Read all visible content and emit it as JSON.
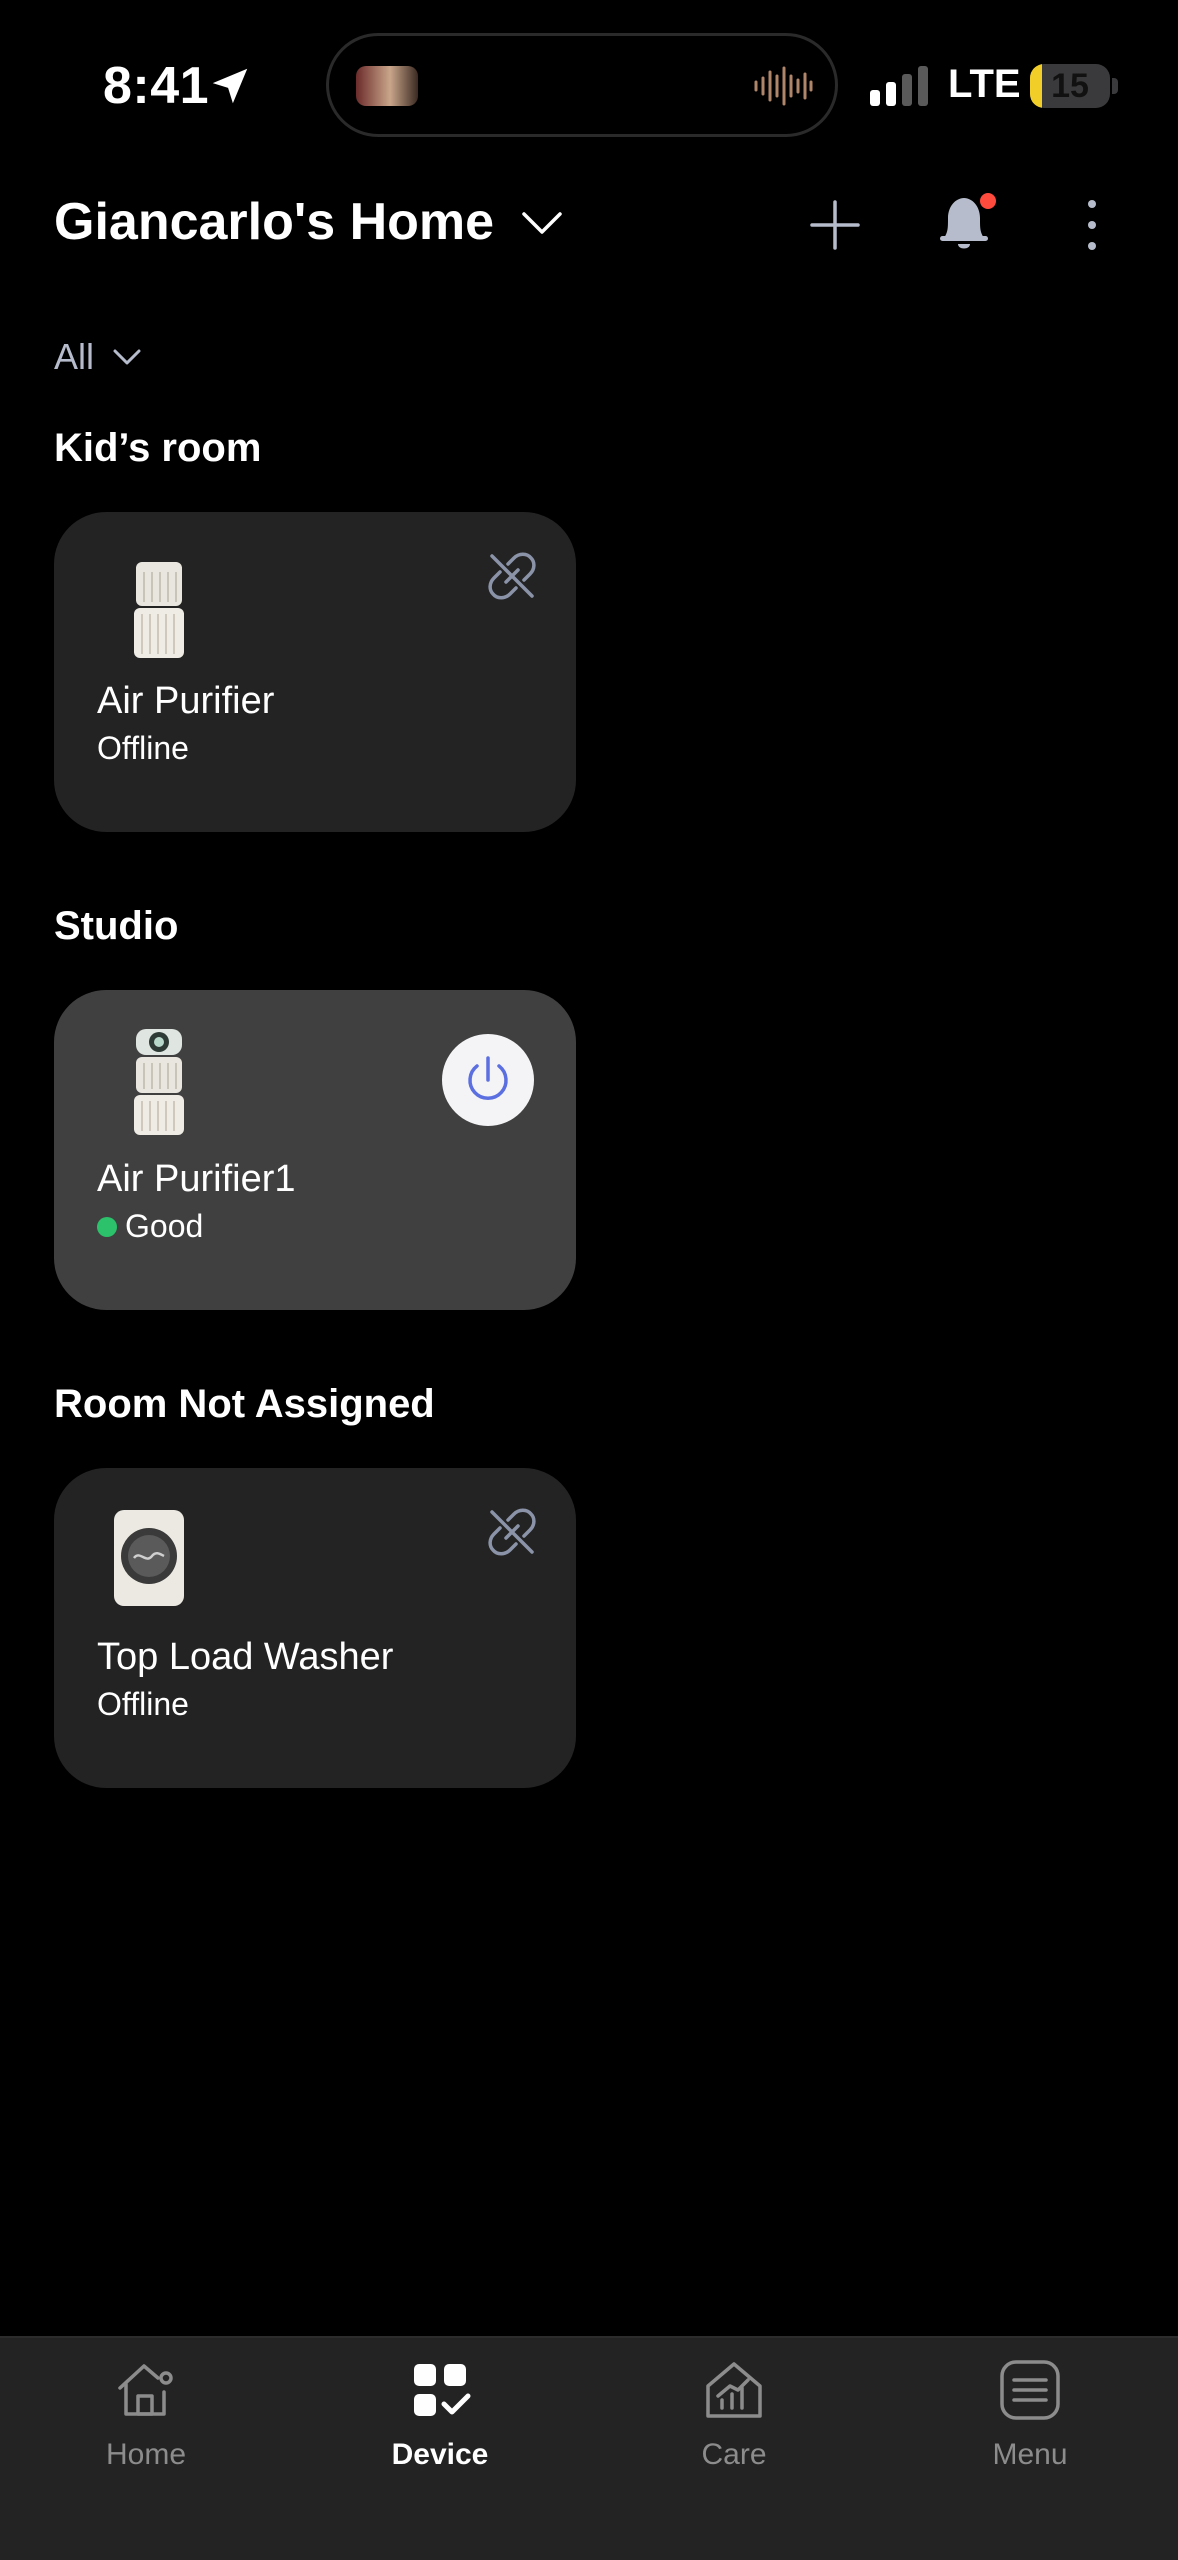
{
  "status_bar": {
    "time": "8:41",
    "network": "LTE",
    "battery_percent": 15,
    "battery_label": "15"
  },
  "header": {
    "home_name": "Giancarlo's Home",
    "icons": [
      "chevron-down-icon",
      "plus-icon",
      "bell-icon",
      "more-vertical-icon"
    ],
    "notification_dot_color": "#ff4b3e"
  },
  "filter": {
    "selected": "All"
  },
  "rooms": [
    {
      "title": "Kid’s room",
      "devices": [
        {
          "name": "Air Purifier",
          "status": "Offline",
          "state_icon": "unlink-icon"
        }
      ]
    },
    {
      "title": "Studio",
      "devices": [
        {
          "name": "Air Purifier1",
          "status": "Good",
          "status_color": "#2bc26b",
          "state_icon": "power-icon"
        }
      ]
    },
    {
      "title": "Room Not Assigned",
      "devices": [
        {
          "name": "Top Load Washer",
          "status": "Offline",
          "state_icon": "unlink-icon"
        }
      ]
    }
  ],
  "bottom_nav": {
    "items": [
      {
        "label": "Home",
        "icon": "home-icon"
      },
      {
        "label": "Device",
        "icon": "device-grid-icon",
        "active": true
      },
      {
        "label": "Care",
        "icon": "care-chart-icon"
      },
      {
        "label": "Menu",
        "icon": "menu-icon"
      }
    ]
  },
  "colors": {
    "background": "#000000",
    "card": "#232323",
    "card_active": "#404040",
    "accent_blue": "#5b6fe0",
    "battery": "#f2cf28"
  }
}
